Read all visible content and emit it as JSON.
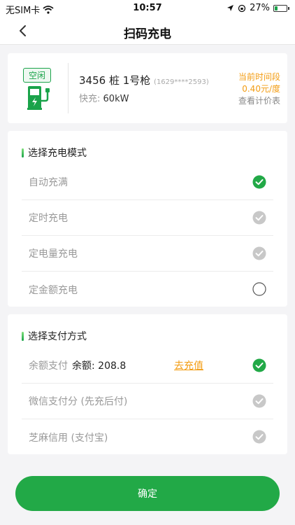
{
  "status_bar": {
    "carrier": "无SIM卡",
    "time": "10:57",
    "battery_pct": "27%",
    "battery_level": 0.27
  },
  "nav": {
    "title": "扫码充电"
  },
  "station": {
    "status": "空闲",
    "name": "3456 桩 1号枪",
    "code": "(1629****2593)",
    "power_label": "快充:",
    "power_value": "60kW",
    "price_title": "当前时间段",
    "price_value": "0.40元/度",
    "price_link": "查看计价表"
  },
  "charge_mode": {
    "title": "选择充电模式",
    "options": [
      {
        "label": "自动充满",
        "state": "selected"
      },
      {
        "label": "定时充电",
        "state": "disabled"
      },
      {
        "label": "定电量充电",
        "state": "disabled"
      },
      {
        "label": "定金额充电",
        "state": "unselected"
      }
    ]
  },
  "payment": {
    "title": "选择支付方式",
    "balance_label": "余额支付",
    "balance_amount": "余额: 208.8",
    "recharge_link": "去充值",
    "options": [
      {
        "label": "微信支付分 (先充后付)",
        "state": "disabled"
      },
      {
        "label": "芝麻信用 (支付宝)",
        "state": "disabled"
      }
    ]
  },
  "confirm_label": "确定",
  "colors": {
    "brand_green": "#22a947",
    "accent_orange": "#f39c12",
    "disabled_gray": "#c8c8c8"
  }
}
